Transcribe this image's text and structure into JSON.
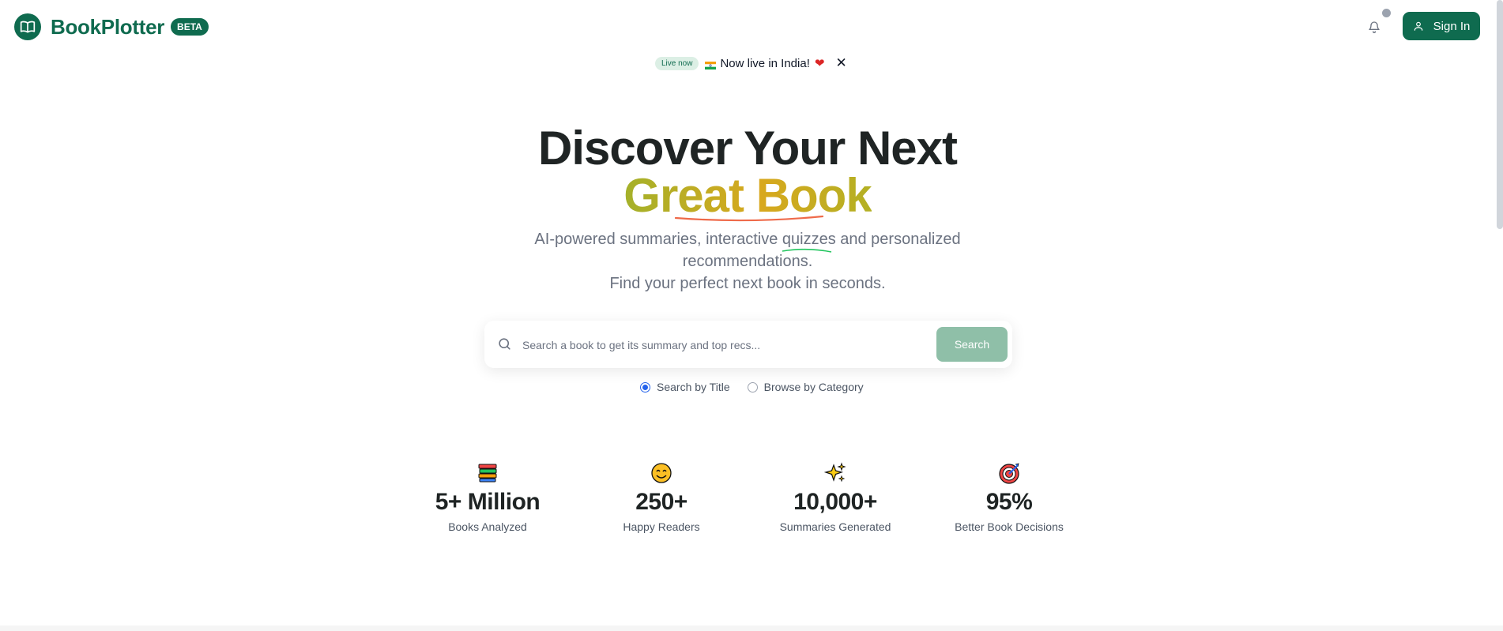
{
  "header": {
    "brand": "BookPlotter",
    "beta_badge": "BETA",
    "sign_in_label": "Sign In"
  },
  "announcement": {
    "pill": "Live now",
    "text": "Now live in India!"
  },
  "hero": {
    "line1": "Discover Your Next",
    "line2": "Great Book",
    "subtitle_part1": "AI-powered summaries, interactive ",
    "subtitle_highlight": "quizzes",
    "subtitle_part2": " and personalized",
    "subtitle_line2": "recommendations.",
    "subtitle_line3": "Find your perfect next book in seconds."
  },
  "search": {
    "placeholder": "Search a book to get its summary and top recs...",
    "button_label": "Search",
    "mode_title": "Search by Title",
    "mode_category": "Browse by Category",
    "selected_mode": "Search by Title"
  },
  "stats": [
    {
      "icon": "books-icon",
      "value": "5+ Million",
      "label": "Books Analyzed"
    },
    {
      "icon": "smiley-icon",
      "value": "250+",
      "label": "Happy Readers"
    },
    {
      "icon": "sparkles-icon",
      "value": "10,000+",
      "label": "Summaries Generated"
    },
    {
      "icon": "target-icon",
      "value": "95%",
      "label": "Better Book Decisions"
    }
  ],
  "colors": {
    "brand": "#0f6b4f",
    "search_button": "#8fbfa8",
    "gradient_start": "#a4b12a",
    "gradient_mid": "#d8a81e"
  }
}
